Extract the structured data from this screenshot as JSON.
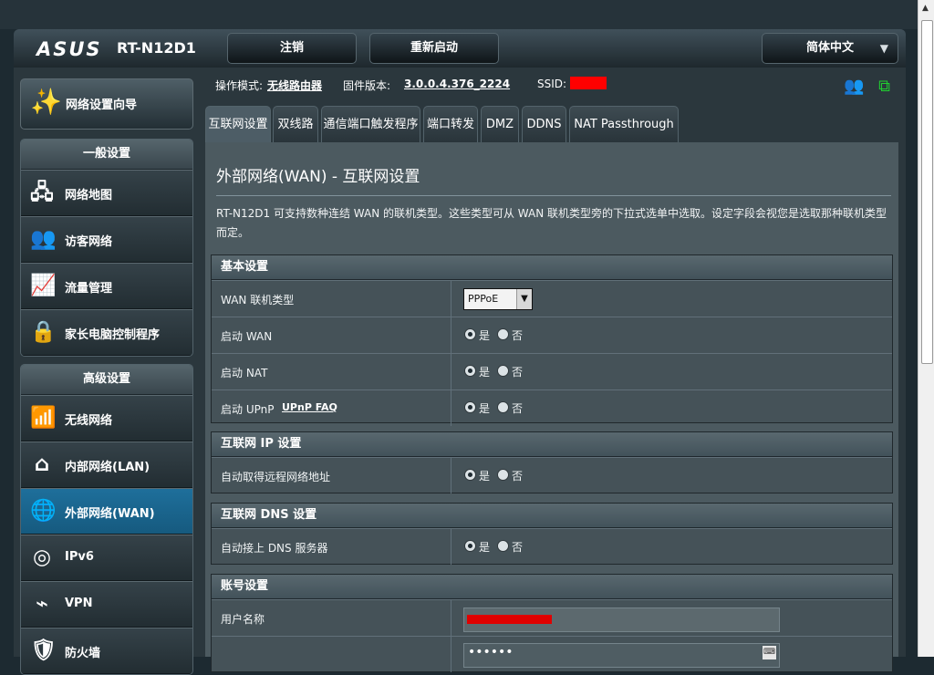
{
  "header": {
    "logo": "ASUS",
    "model": "RT-N12D1",
    "logout_label": "注销",
    "reboot_label": "重新启动",
    "language_label": "简体中文",
    "language_caret": "▼"
  },
  "status": {
    "mode_label": "操作模式:",
    "mode_value": "无线路由器",
    "firmware_label": "固件版本:",
    "firmware_value": "3.0.0.4.376_2224",
    "ssid_label": "SSID:"
  },
  "sidebar": {
    "wizard_label": "网络设置向导",
    "general_title": "一般设置",
    "general_items": [
      {
        "label": "网络地图"
      },
      {
        "label": "访客网络"
      },
      {
        "label": "流量管理"
      },
      {
        "label": "家长电脑控制程序"
      }
    ],
    "advanced_title": "高级设置",
    "advanced_items": [
      {
        "label": "无线网络"
      },
      {
        "label": "内部网络(LAN)"
      },
      {
        "label": "外部网络(WAN)"
      },
      {
        "label": "IPv6"
      },
      {
        "label": "VPN"
      },
      {
        "label": "防火墙"
      }
    ]
  },
  "tabs": [
    {
      "label": "互联网设置"
    },
    {
      "label": "双线路"
    },
    {
      "label": "通信端口触发程序"
    },
    {
      "label": "端口转发"
    },
    {
      "label": "DMZ"
    },
    {
      "label": "DDNS"
    },
    {
      "label": "NAT Passthrough"
    }
  ],
  "main": {
    "title": "外部网络(WAN) - 互联网设置",
    "description": "RT-N12D1 可支持数种连结 WAN 的联机类型。这些类型可从 WAN 联机类型旁的下拉式选单中选取。设定字段会视您是选取那种联机类型而定。",
    "sections": {
      "basic": {
        "title": "基本设置",
        "wan_type_label": "WAN 联机类型",
        "wan_type_value": "PPPoE",
        "enable_wan_label": "启动 WAN",
        "enable_nat_label": "启动 NAT",
        "enable_upnp_label": "启动 UPnP",
        "upnp_faq_label": "UPnP  FAQ"
      },
      "ip": {
        "title": "互联网 IP 设置",
        "auto_ip_label": "自动取得远程网络地址"
      },
      "dns": {
        "title": "互联网 DNS 设置",
        "auto_dns_label": "自动接上 DNS 服务器"
      },
      "account": {
        "title": "账号设置",
        "username_label": "用户名称",
        "password_value": "••••••"
      }
    },
    "yes_label": "是",
    "no_label": "否"
  }
}
